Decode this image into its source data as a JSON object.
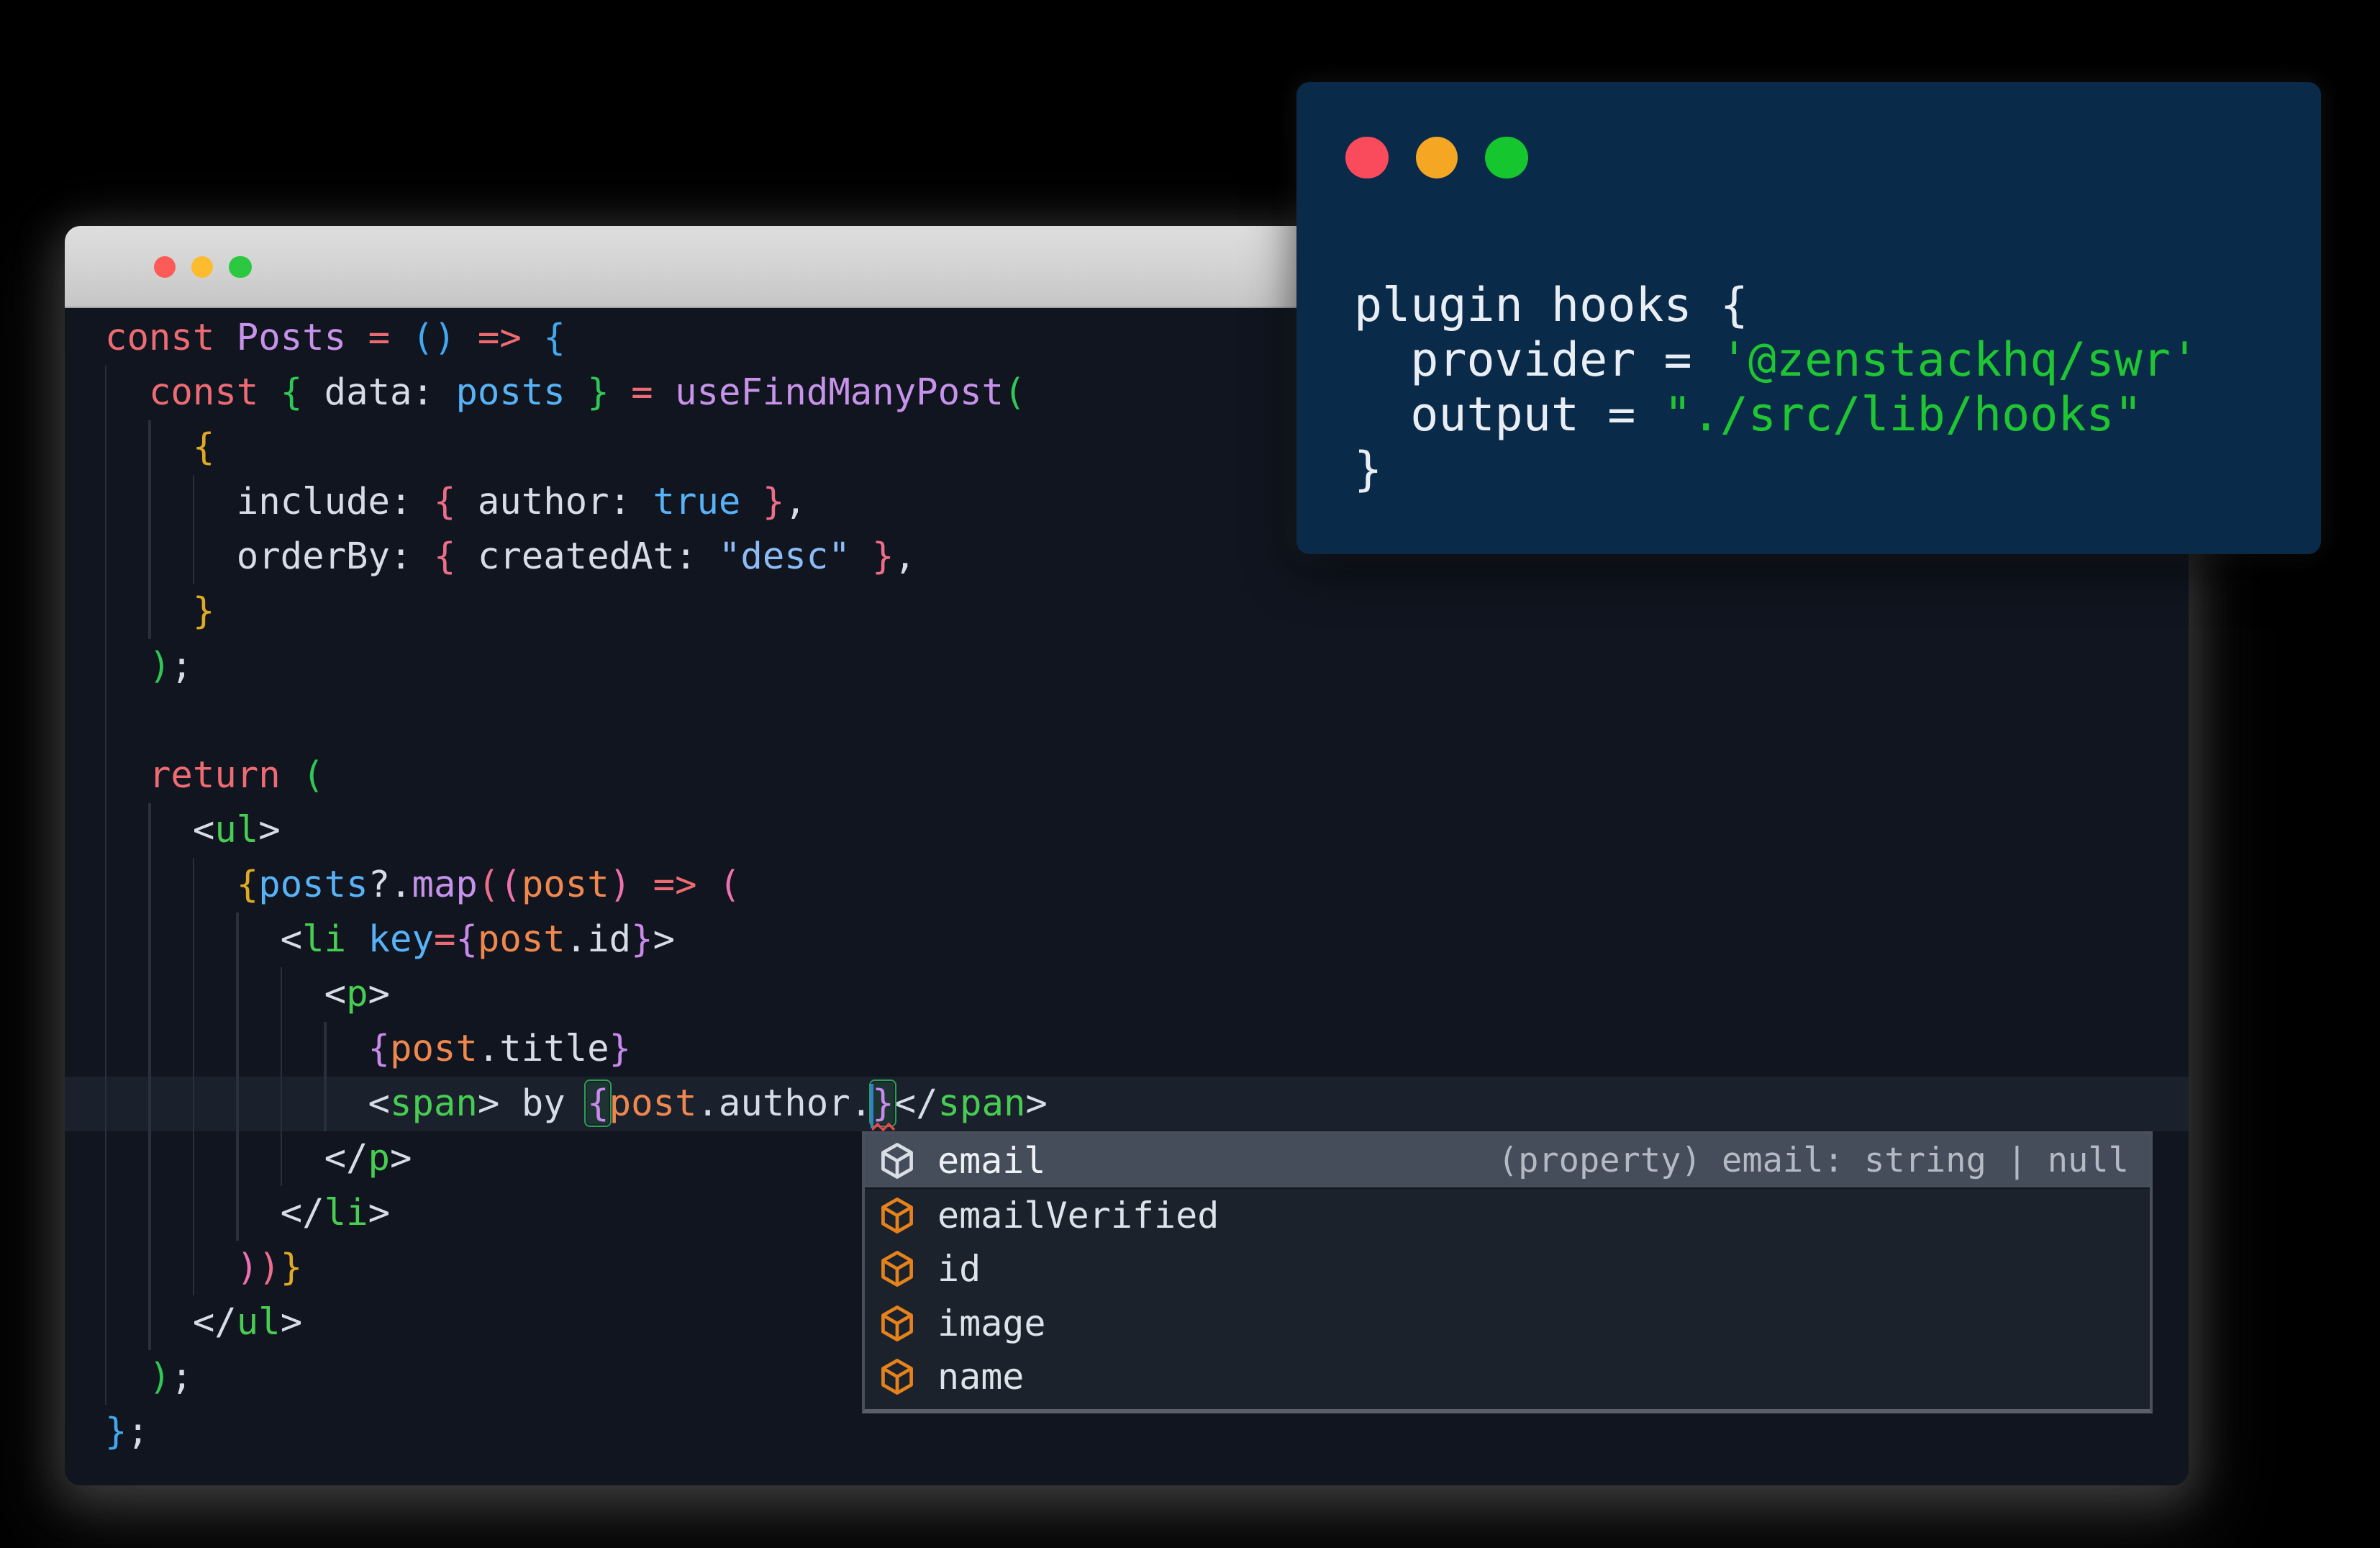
{
  "colors": {
    "editor_bg": "#10151f",
    "current_line_bg": "#1a212d",
    "overlay_bg": "#0a2a49",
    "suggest_bg": "#1b222c",
    "suggest_selected_bg": "#454d5a",
    "cursor": "#2e7ce9",
    "squiggle": "#e5484d",
    "bracket_match": "#2e9e52",
    "traffic_red": "#fc5b57",
    "traffic_yellow": "#fdbc2e",
    "traffic_green": "#2bc840",
    "overlay_red": "#f94b5b",
    "overlay_yellow": "#f5a623",
    "overlay_green": "#16c62f",
    "icon_field_orange": "#e5821c",
    "icon_field_white": "#d9dee4",
    "token": {
      "k": "#ef6b73",
      "fn": "#c792ea",
      "w": "#d6dde8",
      "v": "#58b2f6",
      "s": "#8cbcf5",
      "o": "#f0884e",
      "tag": "#47cd52",
      "b1": "#42a8f0",
      "b2": "#30c754",
      "b3": "#dfa926",
      "b4": "#ee6e8a",
      "b5": "#ef72ae",
      "b6": "#c889ea",
      "ow": "#e9eef4",
      "og": "#20c632"
    }
  },
  "editor_window": {
    "title_bar": {
      "buttons": [
        "close",
        "minimize",
        "zoom"
      ]
    },
    "code": {
      "lines": [
        [
          {
            "c": "k",
            "t": "const "
          },
          {
            "c": "fn",
            "t": "Posts "
          },
          {
            "c": "k",
            "t": "="
          },
          {
            "c": "w",
            "t": " "
          },
          {
            "c": "b1",
            "t": "()"
          },
          {
            "c": "w",
            "t": " "
          },
          {
            "c": "k",
            "t": "=>"
          },
          {
            "c": "w",
            "t": " "
          },
          {
            "c": "b1",
            "t": "{"
          }
        ],
        [
          {
            "c": "w",
            "t": "  "
          },
          {
            "c": "k",
            "t": "const "
          },
          {
            "c": "b2",
            "t": "{"
          },
          {
            "c": "w",
            "t": " data: "
          },
          {
            "c": "v",
            "t": "posts"
          },
          {
            "c": "w",
            "t": " "
          },
          {
            "c": "b2",
            "t": "}"
          },
          {
            "c": "w",
            "t": " "
          },
          {
            "c": "k",
            "t": "="
          },
          {
            "c": "w",
            "t": " "
          },
          {
            "c": "fn",
            "t": "useFindManyPost"
          },
          {
            "c": "b2",
            "t": "("
          }
        ],
        [
          {
            "c": "w",
            "t": "    "
          },
          {
            "c": "b3",
            "t": "{"
          }
        ],
        [
          {
            "c": "w",
            "t": "      include: "
          },
          {
            "c": "b4",
            "t": "{"
          },
          {
            "c": "w",
            "t": " author: "
          },
          {
            "c": "v",
            "t": "true"
          },
          {
            "c": "w",
            "t": " "
          },
          {
            "c": "b4",
            "t": "}"
          },
          {
            "c": "w",
            "t": ","
          }
        ],
        [
          {
            "c": "w",
            "t": "      orderBy: "
          },
          {
            "c": "b4",
            "t": "{"
          },
          {
            "c": "w",
            "t": " createdAt: "
          },
          {
            "c": "s",
            "t": "\"desc\""
          },
          {
            "c": "w",
            "t": " "
          },
          {
            "c": "b4",
            "t": "}"
          },
          {
            "c": "w",
            "t": ","
          }
        ],
        [
          {
            "c": "w",
            "t": "    "
          },
          {
            "c": "b3",
            "t": "}"
          }
        ],
        [
          {
            "c": "w",
            "t": "  "
          },
          {
            "c": "b2",
            "t": ")"
          },
          {
            "c": "w",
            "t": ";"
          }
        ],
        [],
        [
          {
            "c": "w",
            "t": "  "
          },
          {
            "c": "k",
            "t": "return "
          },
          {
            "c": "b2",
            "t": "("
          }
        ],
        [
          {
            "c": "w",
            "t": "    <"
          },
          {
            "c": "tag",
            "t": "ul"
          },
          {
            "c": "w",
            "t": ">"
          }
        ],
        [
          {
            "c": "w",
            "t": "      "
          },
          {
            "c": "b3",
            "t": "{"
          },
          {
            "c": "v",
            "t": "posts"
          },
          {
            "c": "w",
            "t": "?."
          },
          {
            "c": "fn",
            "t": "map"
          },
          {
            "c": "b4",
            "t": "("
          },
          {
            "c": "b5",
            "t": "("
          },
          {
            "c": "o",
            "t": "post"
          },
          {
            "c": "b5",
            "t": ")"
          },
          {
            "c": "w",
            "t": " "
          },
          {
            "c": "k",
            "t": "=>"
          },
          {
            "c": "w",
            "t": " "
          },
          {
            "c": "b5",
            "t": "("
          }
        ],
        [
          {
            "c": "w",
            "t": "        <"
          },
          {
            "c": "tag",
            "t": "li"
          },
          {
            "c": "w",
            "t": " "
          },
          {
            "c": "v",
            "t": "key"
          },
          {
            "c": "k",
            "t": "="
          },
          {
            "c": "b6",
            "t": "{"
          },
          {
            "c": "o",
            "t": "post"
          },
          {
            "c": "w",
            "t": ".id"
          },
          {
            "c": "b6",
            "t": "}"
          },
          {
            "c": "w",
            "t": ">"
          }
        ],
        [
          {
            "c": "w",
            "t": "          <"
          },
          {
            "c": "tag",
            "t": "p"
          },
          {
            "c": "w",
            "t": ">"
          }
        ],
        [
          {
            "c": "w",
            "t": "            "
          },
          {
            "c": "b6",
            "t": "{"
          },
          {
            "c": "o",
            "t": "post"
          },
          {
            "c": "w",
            "t": ".title"
          },
          {
            "c": "b6",
            "t": "}"
          }
        ],
        [
          {
            "c": "w",
            "t": "            <"
          },
          {
            "c": "tag",
            "t": "span"
          },
          {
            "c": "w",
            "t": "> by "
          },
          {
            "c": "b6",
            "t": "{",
            "box": true
          },
          {
            "c": "o",
            "t": "post"
          },
          {
            "c": "w",
            "t": ".author."
          },
          {
            "cursor": true
          },
          {
            "c": "b6",
            "t": "}",
            "box": true,
            "squiggle": true
          },
          {
            "c": "w",
            "t": "</"
          },
          {
            "c": "tag",
            "t": "span"
          },
          {
            "c": "w",
            "t": ">"
          }
        ],
        [
          {
            "c": "w",
            "t": "          </"
          },
          {
            "c": "tag",
            "t": "p"
          },
          {
            "c": "w",
            "t": ">"
          }
        ],
        [
          {
            "c": "w",
            "t": "        </"
          },
          {
            "c": "tag",
            "t": "li"
          },
          {
            "c": "w",
            "t": ">"
          }
        ],
        [
          {
            "c": "w",
            "t": "      "
          },
          {
            "c": "b5",
            "t": ")"
          },
          {
            "c": "b4",
            "t": ")"
          },
          {
            "c": "b3",
            "t": "}"
          }
        ],
        [
          {
            "c": "w",
            "t": "    </"
          },
          {
            "c": "tag",
            "t": "ul"
          },
          {
            "c": "w",
            "t": ">"
          }
        ],
        [
          {
            "c": "w",
            "t": "  "
          },
          {
            "c": "b2",
            "t": ")"
          },
          {
            "c": "w",
            "t": ";"
          }
        ],
        [
          {
            "c": "b1",
            "t": "}"
          },
          {
            "c": "w",
            "t": ";"
          }
        ]
      ]
    }
  },
  "suggest_widget": {
    "items": [
      {
        "label": "email",
        "kind": "field",
        "selected": true,
        "hint": "(property) email: string | null"
      },
      {
        "label": "emailVerified",
        "kind": "field"
      },
      {
        "label": "id",
        "kind": "field"
      },
      {
        "label": "image",
        "kind": "field"
      },
      {
        "label": "name",
        "kind": "field"
      }
    ]
  },
  "overlay_window": {
    "title_bar": {
      "buttons": [
        "close",
        "minimize",
        "zoom"
      ]
    },
    "lines": [
      [
        {
          "c": "ow",
          "t": "plugin hooks {"
        }
      ],
      [
        {
          "c": "ow",
          "t": "  provider = "
        },
        {
          "c": "og",
          "t": "'@zenstackhq/swr'"
        }
      ],
      [
        {
          "c": "ow",
          "t": "  output = "
        },
        {
          "c": "og",
          "t": "\"./src/lib/hooks\""
        }
      ],
      [
        {
          "c": "ow",
          "t": "}"
        }
      ]
    ]
  }
}
